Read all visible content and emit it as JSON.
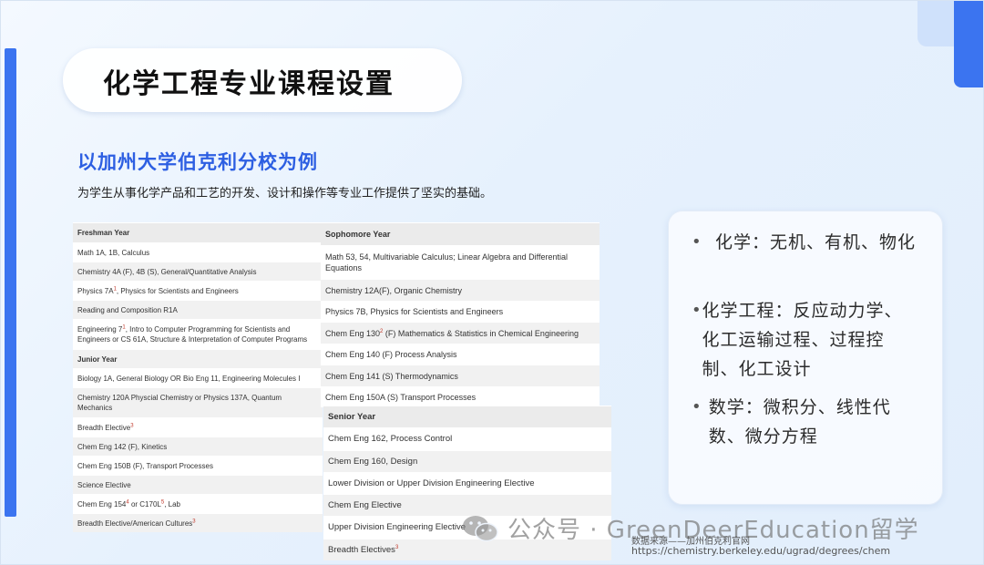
{
  "title": "化学工程专业课程设置",
  "subtitle": "以加州大学伯克利分校为例",
  "description": "为学生从事化学产品和工艺的开发、设计和操作等专业工作提供了坚实的基础。",
  "freshman": {
    "header": "Freshman Year",
    "rows": [
      {
        "text": "Math 1A, 1B, Calculus"
      },
      {
        "text": "Chemistry 4A (F), 4B (S), General/Quantitative Analysis"
      },
      {
        "pre": "Physics 7A",
        "sup": "1",
        "post": ", Physics for Scientists and Engineers"
      },
      {
        "text": "Reading and Composition R1A"
      },
      {
        "pre": "Engineering 7",
        "sup": "1",
        "post": ", Intro to Computer Programming for Scientists and Engineers or CS 61A, Structure & Interpretation of Computer Programs"
      }
    ]
  },
  "junior": {
    "header": "Junior Year",
    "rows": [
      {
        "text": "Biology 1A, General Biology OR Bio Eng 11, Engineering Molecules I"
      },
      {
        "text": "Chemistry 120A Physcial Chemistry or Physics 137A, Quantum Mechanics"
      },
      {
        "pre": "Breadth Elective",
        "sup": "3",
        "post": ""
      },
      {
        "text": "Chem Eng 142 (F), Kinetics"
      },
      {
        "text": "Chem Eng 150B (F), Transport Processes"
      },
      {
        "text": "Science Elective"
      },
      {
        "pre": "Chem Eng 154",
        "sup": "4",
        "post": " or C170L",
        "sup2": "5",
        "post2": ", Lab"
      },
      {
        "pre": "Breadth Elective/American Cultures",
        "sup": "3",
        "post": ""
      }
    ]
  },
  "sophomore": {
    "header": "Sophomore Year",
    "rows": [
      {
        "text": "Math 53, 54, Multivariable Calculus; Linear Algebra and Differential Equations"
      },
      {
        "text": "Chemistry 12A(F), Organic Chemistry"
      },
      {
        "text": "Physics 7B, Physics for Scientists and Engineers"
      },
      {
        "pre": "Chem Eng 130",
        "sup": "2",
        "post": " (F) Mathematics & Statistics in Chemical Engineering"
      },
      {
        "text": "Chem Eng 140 (F) Process Analysis"
      },
      {
        "text": "Chem Eng 141 (S) Thermodynamics"
      },
      {
        "text": "Chem Eng 150A (S) Transport Processes"
      }
    ]
  },
  "senior": {
    "header": "Senior Year",
    "rows": [
      {
        "text": "Chem Eng 162, Process Control"
      },
      {
        "text": "Chem Eng 160, Design"
      },
      {
        "text": "Lower Division or Upper Division Engineering Elective"
      },
      {
        "text": "Chem Eng Elective"
      },
      {
        "text": "Upper Division Engineering Elective"
      },
      {
        "pre": "Breadth Electives",
        "sup": "3",
        "post": ""
      }
    ]
  },
  "card": {
    "bullet_symbol": "•",
    "items": [
      "化学：无机、有机、物化",
      "化学工程：反应动力学、化工运输过程、过程控制、化工设计",
      "数学：微积分、线性代数、微分方程"
    ]
  },
  "watermark": {
    "icon": "wechat-icon",
    "text": "公众号 · GreenDeerEducation留学"
  },
  "source": {
    "label": "数据来源——加州伯克利官网",
    "url": "https://chemistry.berkeley.edu/ugrad/degrees/chem"
  },
  "colors": {
    "accent": "#3b74f0",
    "subtitle": "#2d5fe2"
  }
}
